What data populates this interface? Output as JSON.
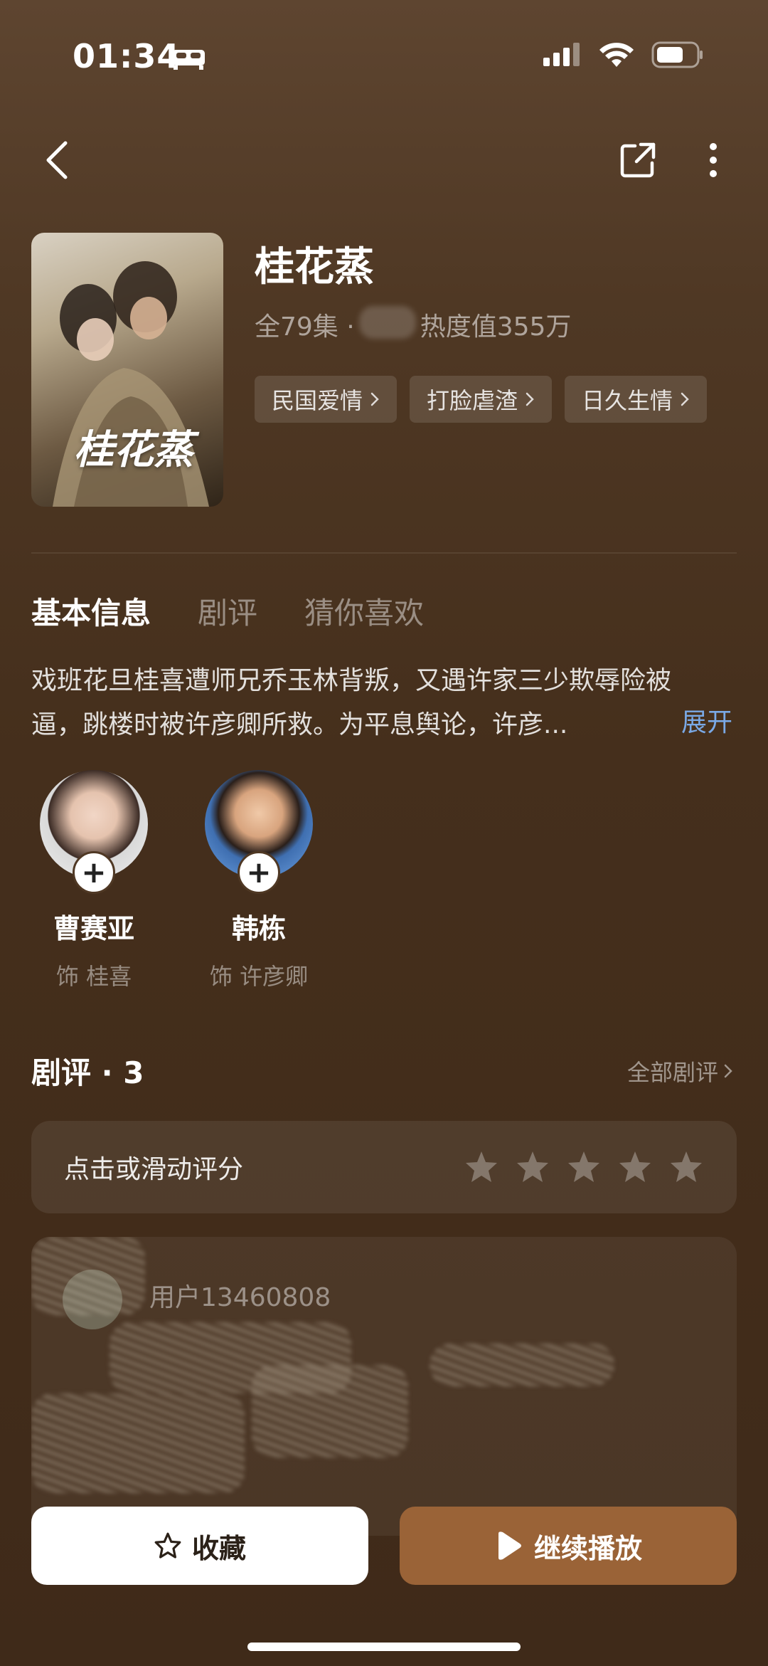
{
  "status_bar": {
    "time": "01:34"
  },
  "header": {
    "title": "桂花蒸",
    "poster_title": "桂花蒸",
    "episodes": "全79集 ·",
    "heat": "热度值355万",
    "tags": [
      "民国爱情",
      "打脸虐渣",
      "日久生情"
    ]
  },
  "tabs": [
    {
      "label": "基本信息",
      "active": true
    },
    {
      "label": "剧评",
      "active": false
    },
    {
      "label": "猜你喜欢",
      "active": false
    }
  ],
  "synopsis": {
    "line1": "戏班花旦桂喜遭师兄乔玉林背叛，又遇许家三少欺辱险被",
    "line2": "逼，跳楼时被许彦卿所救。为平息舆论，许彦...",
    "expand_label": "展开"
  },
  "cast": [
    {
      "name": "曹赛亚",
      "role": "饰 桂喜"
    },
    {
      "name": "韩栋",
      "role": "饰 许彦卿"
    }
  ],
  "reviews": {
    "title": "剧评 · 3",
    "all_label": "全部剧评",
    "rate_prompt": "点击或滑动评分",
    "star_count": 5,
    "first_user": "用户13460808"
  },
  "bottom_bar": {
    "collect_label": "收藏",
    "play_label": "继续播放"
  },
  "colors": {
    "accent": "#9a6337",
    "link": "#7aa9e6"
  }
}
